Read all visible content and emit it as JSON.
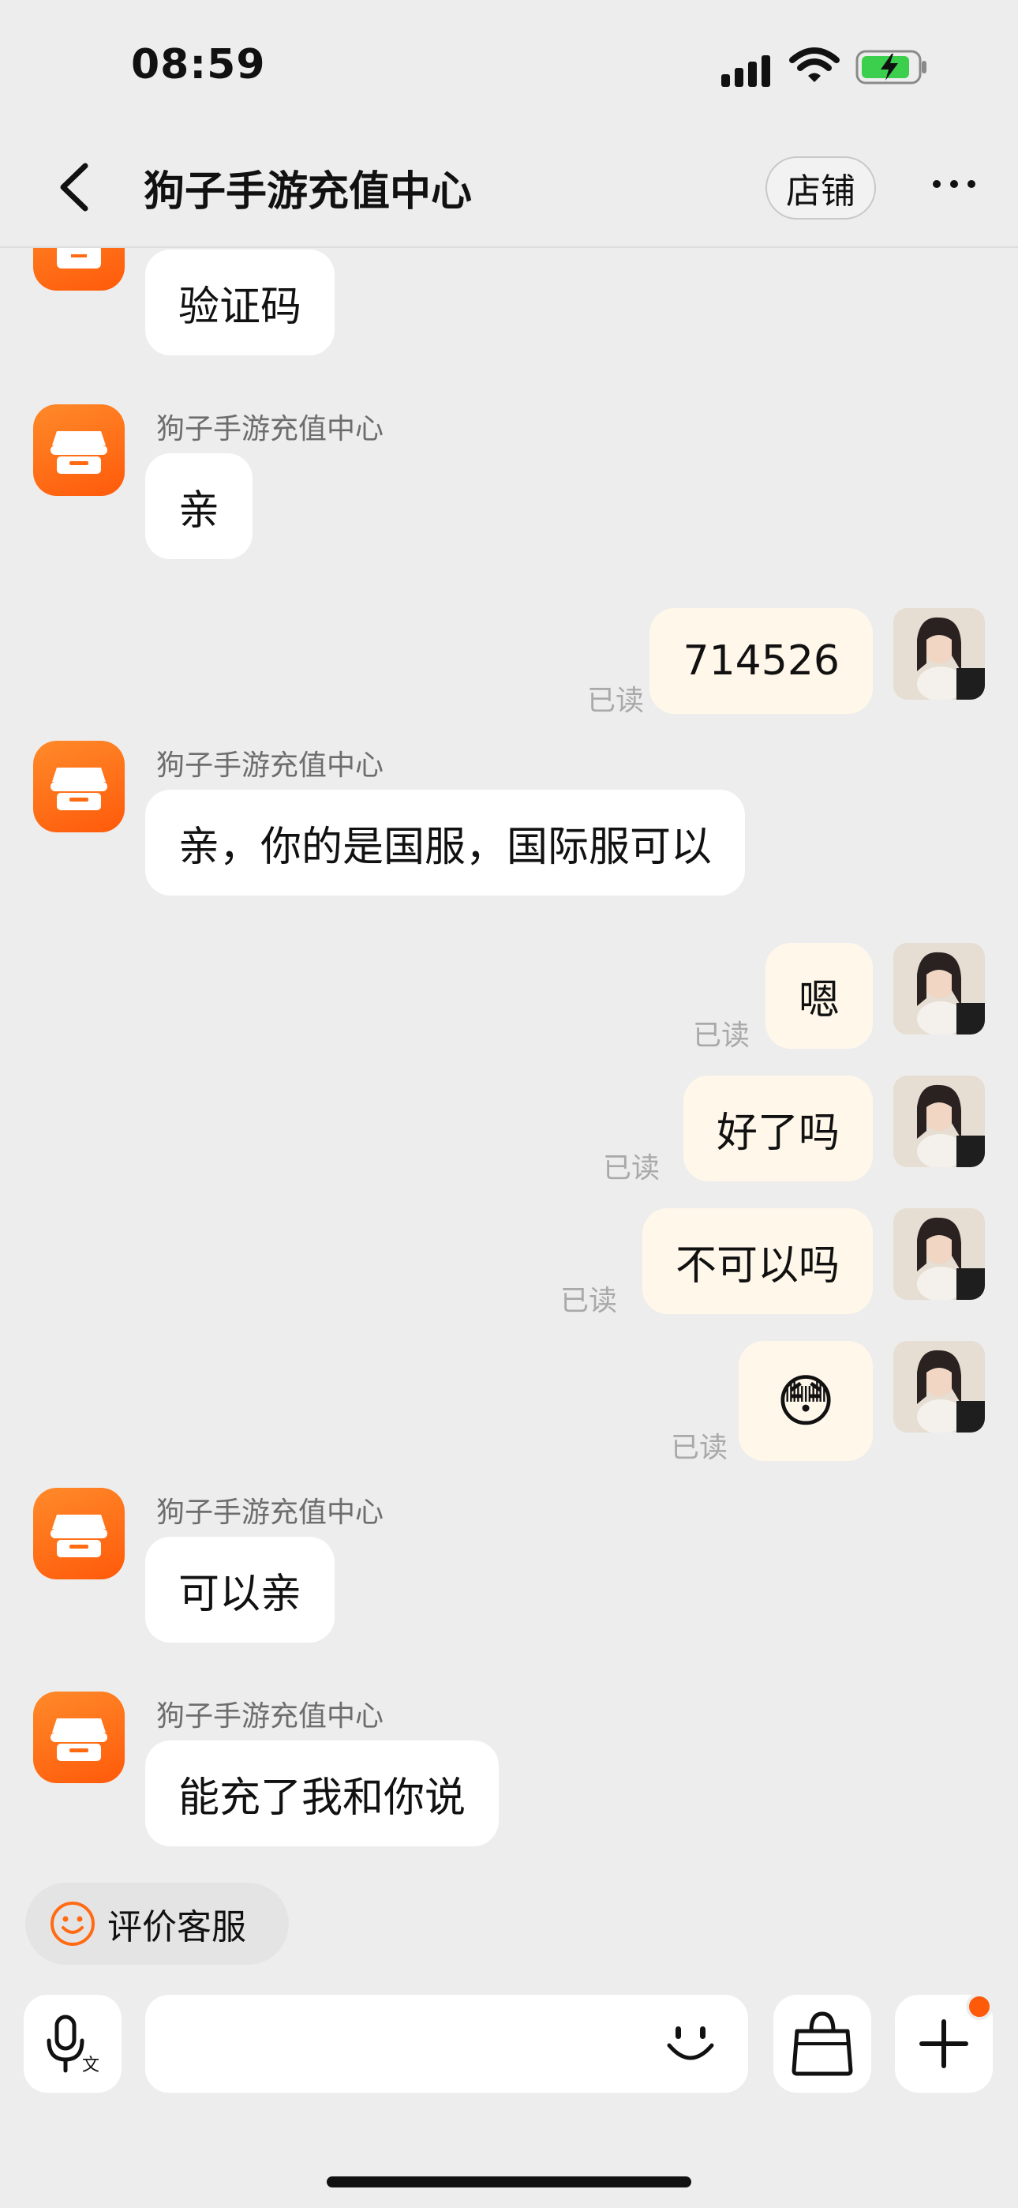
{
  "status": {
    "time": "08:59"
  },
  "nav": {
    "title": "狗子手游充值中心",
    "shop_button": "店铺"
  },
  "colors": {
    "brand": "#ff6a13",
    "bubble_out": "#fff7ea",
    "bubble_in": "#ffffff",
    "background": "#ededed",
    "unread_dot": "#ff5a0a"
  },
  "messages": [
    {
      "from": "shop",
      "text": "验证码"
    },
    {
      "from": "shop",
      "sender": "狗子手游充值中心",
      "text": "亲"
    },
    {
      "from": "me",
      "text": "714526",
      "status": "已读"
    },
    {
      "from": "shop",
      "sender": "狗子手游充值中心",
      "text": "亲，你的是国服，国际服可以"
    },
    {
      "from": "me",
      "text": "嗯",
      "status": "已读"
    },
    {
      "from": "me",
      "text": "好了吗",
      "status": "已读"
    },
    {
      "from": "me",
      "text": "不可以吗",
      "status": "已读"
    },
    {
      "from": "me",
      "text": "😳",
      "status": "已读"
    },
    {
      "from": "shop",
      "sender": "狗子手游充值中心",
      "text": "可以亲"
    },
    {
      "from": "shop",
      "sender": "狗子手游充值中心",
      "text": "能充了我和你说"
    }
  ],
  "rate_service": {
    "label": "评价客服",
    "icon": "smiley-icon"
  },
  "input_bar": {
    "voice_icon": "voice-translate-icon",
    "emoji_icon": "emoji-icon",
    "bag_icon": "shopping-bag-icon",
    "plus_icon": "plus-icon"
  }
}
